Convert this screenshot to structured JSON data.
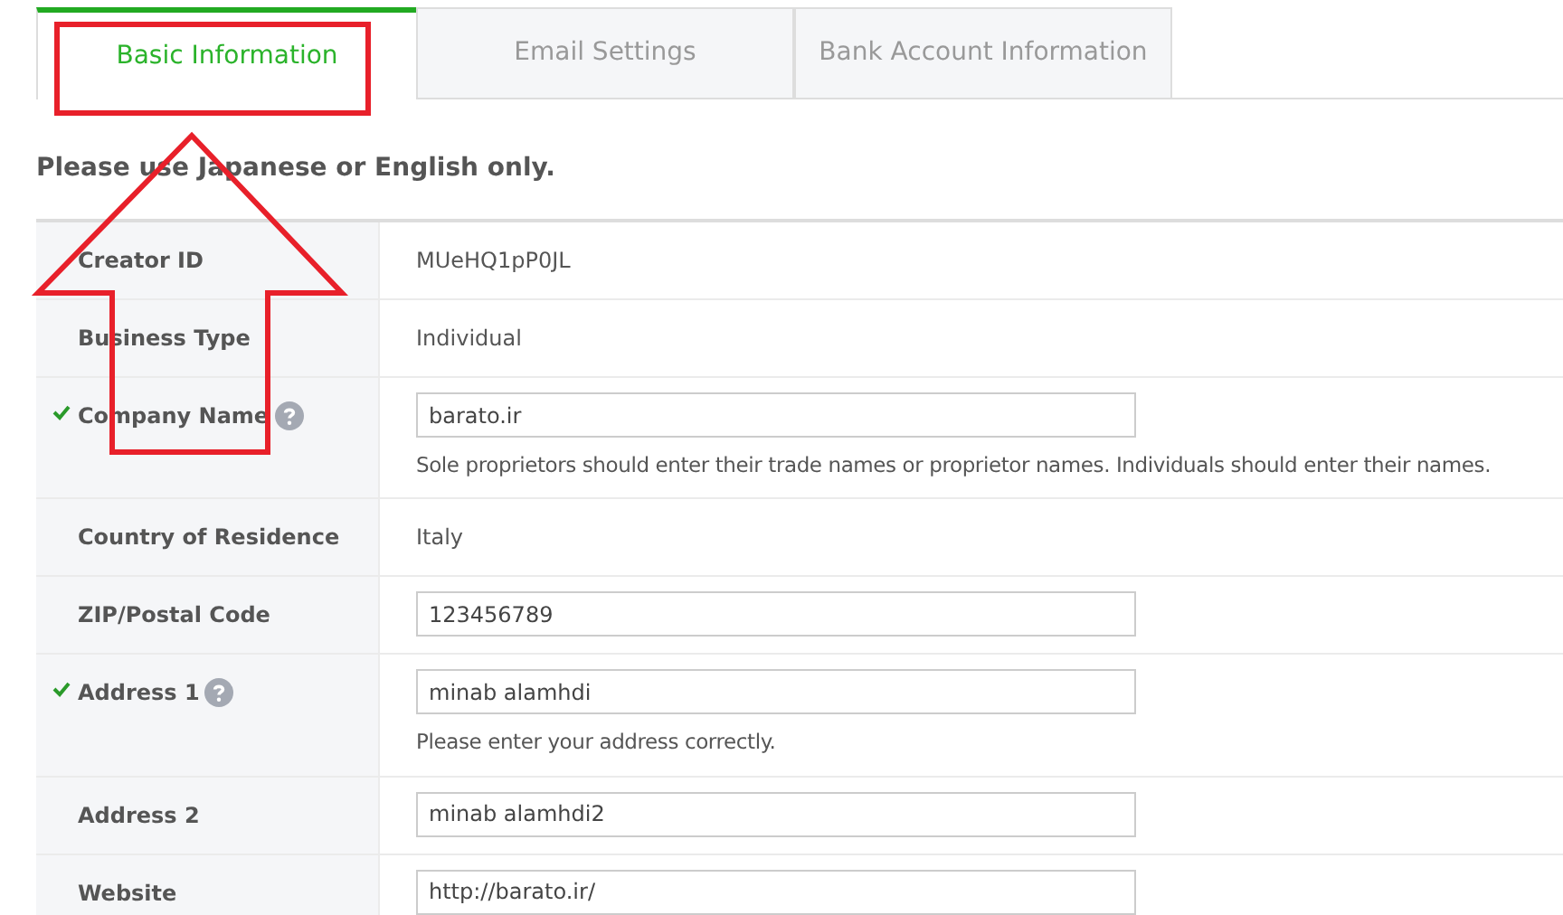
{
  "tabs": [
    {
      "label": "Basic Information",
      "selected": true
    },
    {
      "label": "Email Settings",
      "selected": false
    },
    {
      "label": "Bank Account Information",
      "selected": false
    }
  ],
  "notice": "Please use Japanese or English only.",
  "fields": [
    {
      "kind": "text",
      "label": "Creator ID",
      "valid": false,
      "help": false,
      "value": "MUeHQ1pP0JL"
    },
    {
      "kind": "text",
      "label": "Business Type",
      "valid": false,
      "help": false,
      "value": "Individual"
    },
    {
      "kind": "input",
      "label": "Company Name",
      "valid": true,
      "help": true,
      "value": "barato.ir",
      "hint": "Sole proprietors should enter their trade names or proprietor names. Individuals should enter their names."
    },
    {
      "kind": "text",
      "label": "Country of Residence",
      "valid": false,
      "help": false,
      "value": "Italy"
    },
    {
      "kind": "input",
      "label": "ZIP/Postal Code",
      "valid": false,
      "help": false,
      "value": "123456789"
    },
    {
      "kind": "input",
      "label": "Address 1",
      "valid": true,
      "help": true,
      "value": "minab alamhdi",
      "hint": "Please enter your address correctly."
    },
    {
      "kind": "input",
      "label": "Address 2",
      "valid": false,
      "help": false,
      "value": "minab alamhdi2"
    },
    {
      "kind": "input",
      "label": "Website",
      "valid": false,
      "help": false,
      "value": "http://barato.ir/"
    }
  ]
}
